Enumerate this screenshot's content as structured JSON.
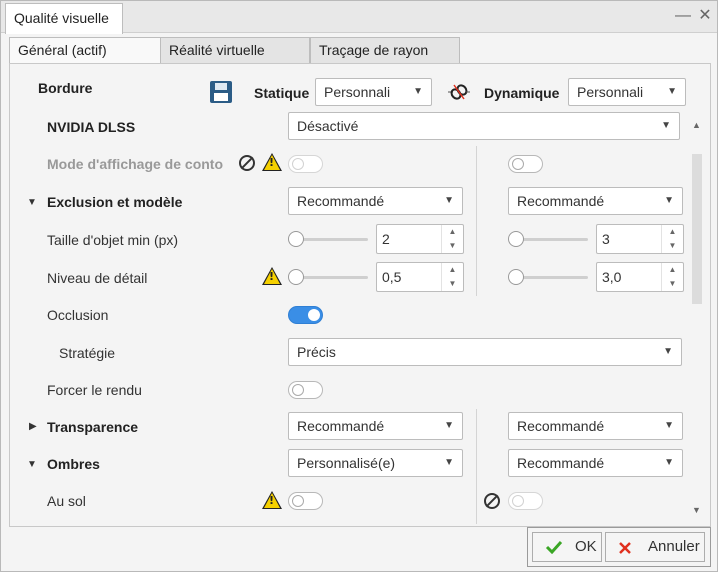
{
  "window": {
    "title": "Qualité visuelle"
  },
  "tabs": [
    {
      "label": "Général (actif)",
      "active": true
    },
    {
      "label": "Réalité virtuelle",
      "active": false
    },
    {
      "label": "Traçage de rayon",
      "active": false
    }
  ],
  "bordure": {
    "label": "Bordure",
    "statique_label": "Statique",
    "statique_value": "Personnali",
    "dynamique_label": "Dynamique",
    "dynamique_value": "Personnali"
  },
  "rows": {
    "dlss": {
      "label": "NVIDIA DLSS",
      "value": "Désactivé"
    },
    "mode": {
      "label": "Mode d'affichage de conto"
    },
    "exclusion": {
      "label": "Exclusion et modèle",
      "static": "Recommandé",
      "dynamic": "Recommandé"
    },
    "taille": {
      "label": "Taille d'objet min (px)",
      "static": "2",
      "dynamic": "3"
    },
    "niveau": {
      "label": "Niveau de détail",
      "static": "0,5",
      "dynamic": "3,0"
    },
    "occlusion": {
      "label": "Occlusion",
      "on": true
    },
    "strategie": {
      "label": "Stratégie",
      "value": "Précis"
    },
    "forcer": {
      "label": "Forcer le rendu"
    },
    "transparence": {
      "label": "Transparence",
      "static": "Recommandé",
      "dynamic": "Recommandé"
    },
    "ombres": {
      "label": "Ombres",
      "static": "Personnalisé(e)",
      "dynamic": "Recommandé"
    },
    "ausol": {
      "label": "Au sol"
    }
  },
  "footer": {
    "ok": "OK",
    "cancel": "Annuler"
  },
  "colors": {
    "accent": "#3a8ee6",
    "ok_check": "#3aa625",
    "cancel_x": "#e0301e",
    "warning": "#f5d000"
  }
}
